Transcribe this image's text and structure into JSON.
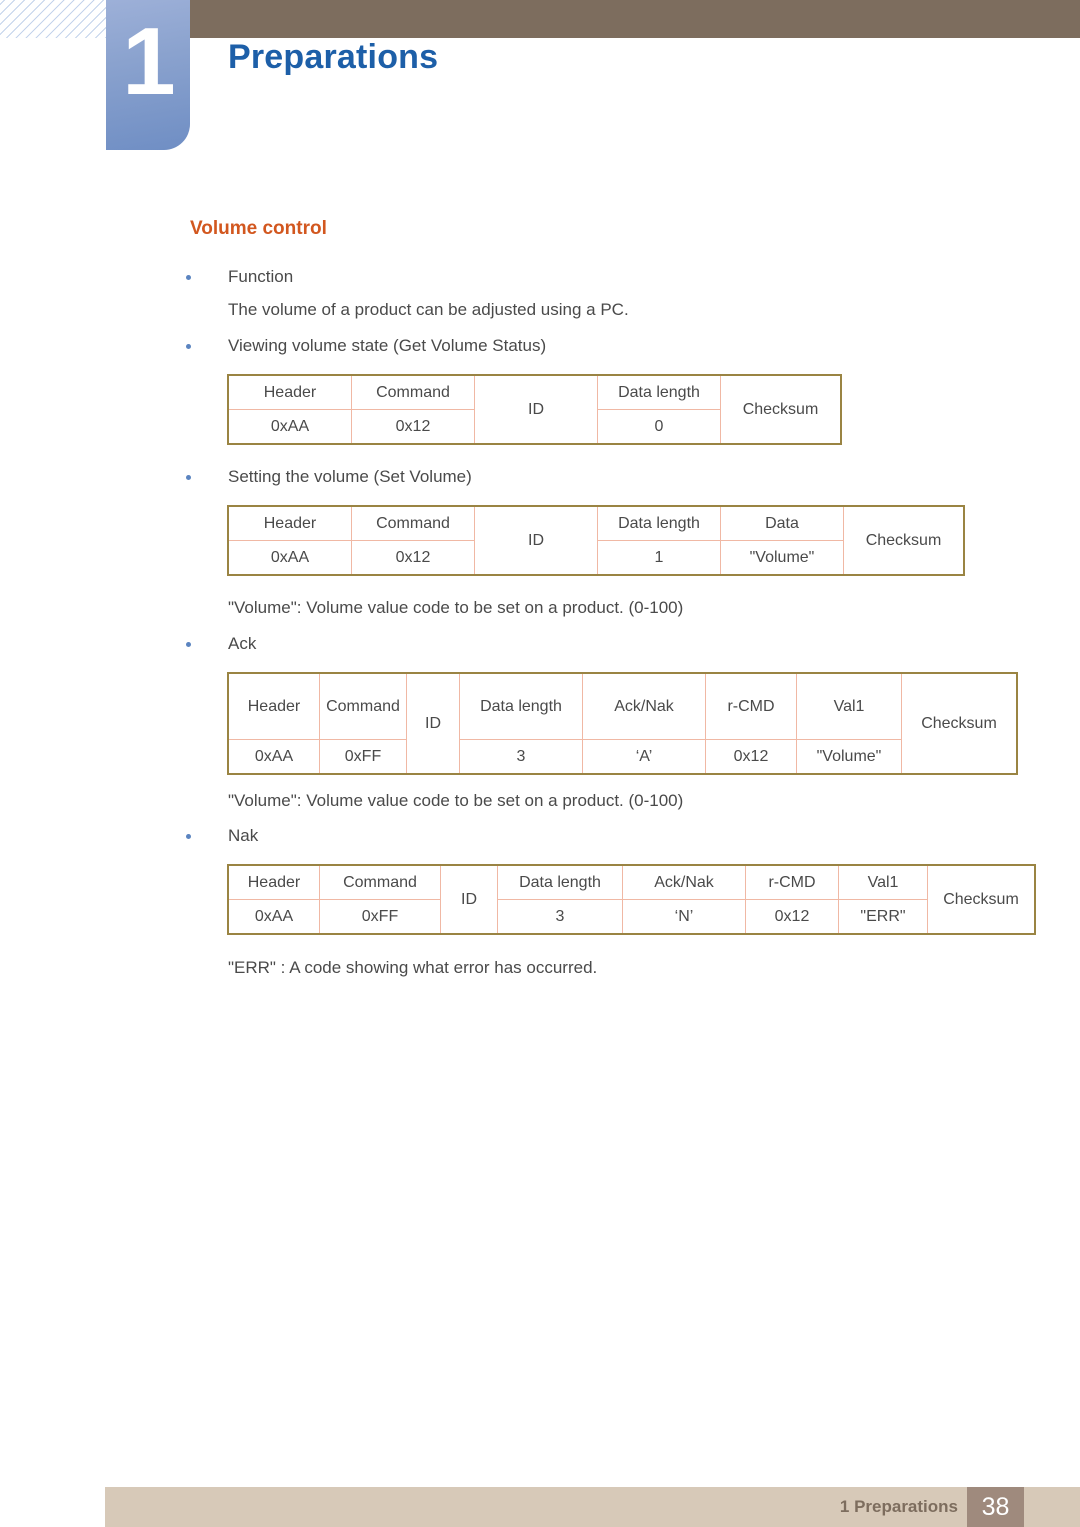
{
  "header": {
    "chapter_number": "1",
    "chapter_title": "Preparations"
  },
  "section": {
    "title": "Volume control"
  },
  "body": {
    "bullet_function": "Function",
    "function_desc": "The volume of a product can be adjusted using a PC.",
    "bullet_get": "Viewing volume state (Get Volume Status)",
    "bullet_set": "Setting the volume (Set Volume)",
    "note_volume_1": "\"Volume\": Volume value code to be set on a product. (0-100)",
    "bullet_ack": "Ack",
    "note_volume_2": "\"Volume\": Volume value code to be set on a product. (0-100)",
    "bullet_nak": "Nak",
    "note_err": "\"ERR\" : A code showing what error has occurred."
  },
  "tables": {
    "get_volume_status": {
      "headers": [
        "Header",
        "Command",
        "ID",
        "Data length",
        "Checksum"
      ],
      "values": [
        "0xAA",
        "0x12",
        "",
        "0",
        ""
      ]
    },
    "set_volume": {
      "headers": [
        "Header",
        "Command",
        "ID",
        "Data length",
        "Data",
        "Checksum"
      ],
      "values": [
        "0xAA",
        "0x12",
        "",
        "1",
        "\"Volume\"",
        ""
      ]
    },
    "ack": {
      "headers": [
        "Header",
        "Command",
        "ID",
        "Data length",
        "Ack/Nak",
        "r-CMD",
        "Val1",
        "Checksum"
      ],
      "values": [
        "0xAA",
        "0xFF",
        "",
        "3",
        "‘A’",
        "0x12",
        "\"Volume\"",
        ""
      ]
    },
    "nak": {
      "headers": [
        "Header",
        "Command",
        "ID",
        "Data length",
        "Ack/Nak",
        "r-CMD",
        "Val1",
        "Checksum"
      ],
      "values": [
        "0xAA",
        "0xFF",
        "",
        "3",
        "‘N’",
        "0x12",
        "\"ERR\"",
        ""
      ]
    }
  },
  "footer": {
    "label": "1 Preparations",
    "page": "38"
  },
  "colors": {
    "chapter_title": "#1d5fa8",
    "section_title": "#d2571f",
    "header_band": "#7d6d5e",
    "badge_blue": "#8aa2ce",
    "table_border": "#9a8443",
    "table_inner": "#f0b8a4",
    "footer_bar": "#d7c9b8",
    "footer_page": "#9f8a7d",
    "bullet": "#5b84c0"
  }
}
